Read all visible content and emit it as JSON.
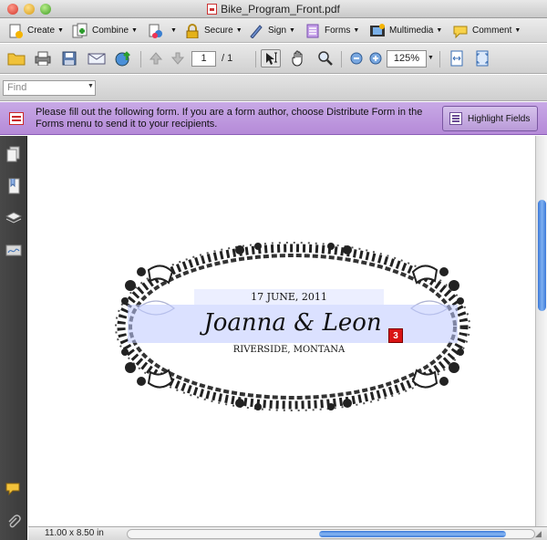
{
  "window": {
    "title": "Bike_Program_Front.pdf"
  },
  "toolbar": {
    "create": "Create",
    "combine": "Combine",
    "secure": "Secure",
    "sign": "Sign",
    "forms": "Forms",
    "multimedia": "Multimedia",
    "comment": "Comment"
  },
  "navigation": {
    "page_current": "1",
    "page_total": "/ 1",
    "zoom": "125%"
  },
  "find": {
    "placeholder": "Find"
  },
  "forms_bar": {
    "message": "Please fill out the following form. If you are a form author, choose Distribute Form in the Forms menu to send it to your recipients.",
    "highlight_button": "Highlight Fields"
  },
  "document": {
    "date": "17 JUNE, 2011",
    "names": "Joanna & Leon",
    "location": "RIVERSIDE, MONTANA",
    "field_badge": "3"
  },
  "status": {
    "page_size": "11.00 x 8.50 in"
  },
  "colors": {
    "forms_bar": "#b58ad8",
    "field_highlight": "#c0c8ff",
    "scroll_thumb": "#3a78d8",
    "badge": "#d91414"
  }
}
